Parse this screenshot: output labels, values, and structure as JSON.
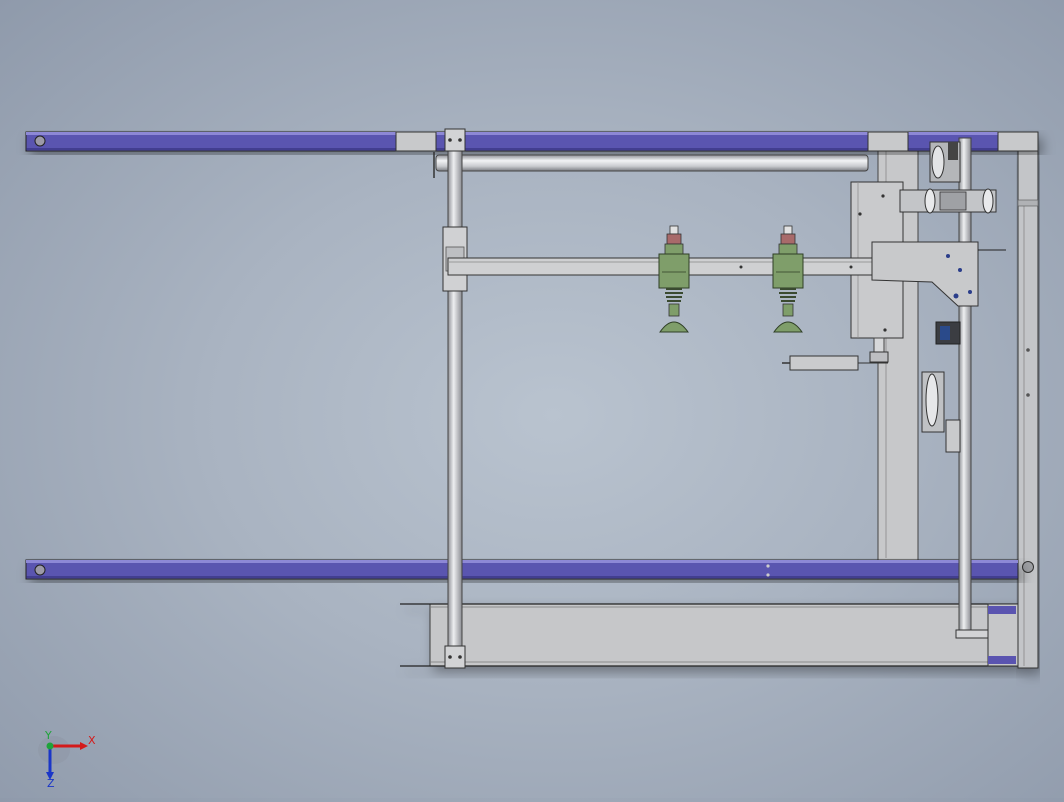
{
  "window": {
    "title": ""
  },
  "viewport": {
    "background_color": "#aeb8c6",
    "frame_rail_color": "#5a54b0",
    "frame_gray_color": "#c4c6c9",
    "suction_cup_color": "#7f9e6a"
  },
  "triad": {
    "x_label": "X",
    "y_label": "Y",
    "z_label": "Z",
    "x_color": "#d41a1a",
    "y_color": "#1fa33a",
    "z_color": "#1a36c8"
  }
}
